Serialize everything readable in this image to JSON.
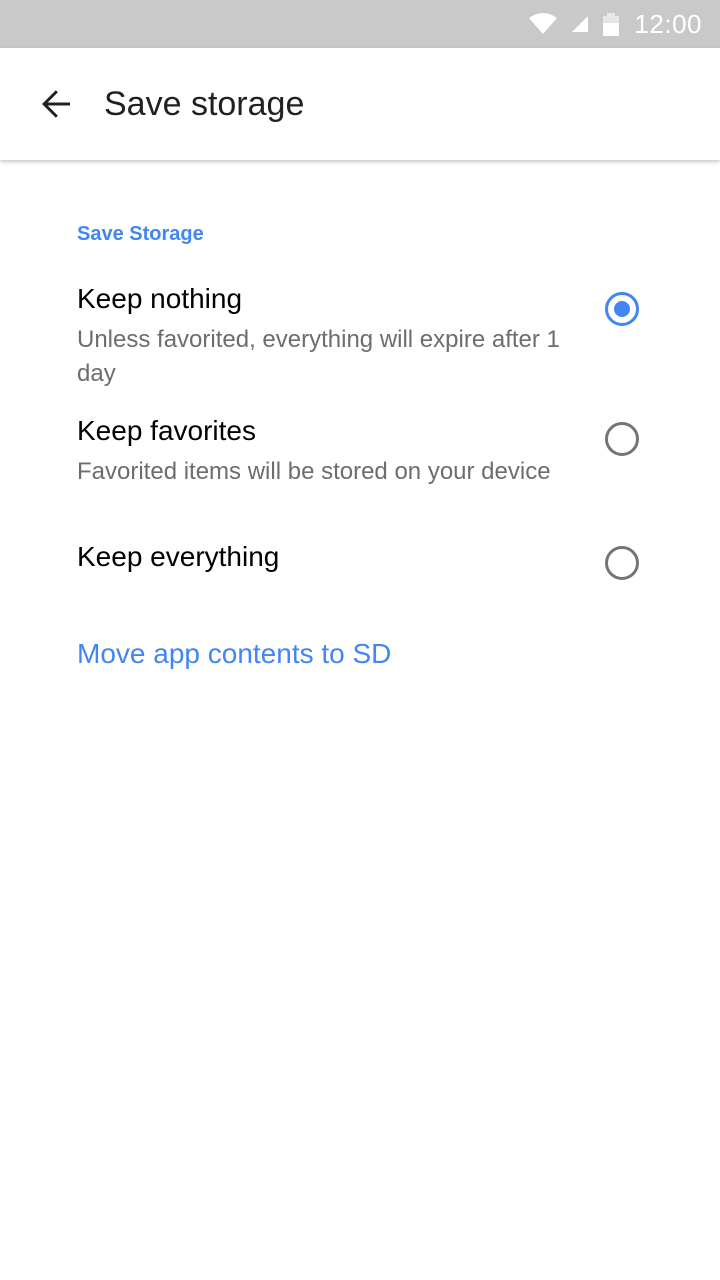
{
  "status_bar": {
    "time": "12:00",
    "icons": [
      "wifi-icon",
      "cell-signal-icon",
      "battery-icon"
    ]
  },
  "app_bar": {
    "back_icon": "arrow-left-icon",
    "title": "Save storage"
  },
  "section": {
    "header": "Save Storage"
  },
  "options": [
    {
      "title": "Keep nothing",
      "description": "Unless favorited, everything will expire after 1 day",
      "selected": true
    },
    {
      "title": "Keep favorites",
      "description": "Favorited items will be stored on your device",
      "selected": false
    },
    {
      "title": "Keep everything",
      "description": "",
      "selected": false
    }
  ],
  "actions": {
    "move_to_sd": "Move app contents to SD"
  },
  "colors": {
    "accent": "#4285f4",
    "status_bar_bg": "#c9c9c9",
    "title_text": "#212121",
    "secondary_text": "#6d6d6d",
    "radio_off": "#757575"
  }
}
